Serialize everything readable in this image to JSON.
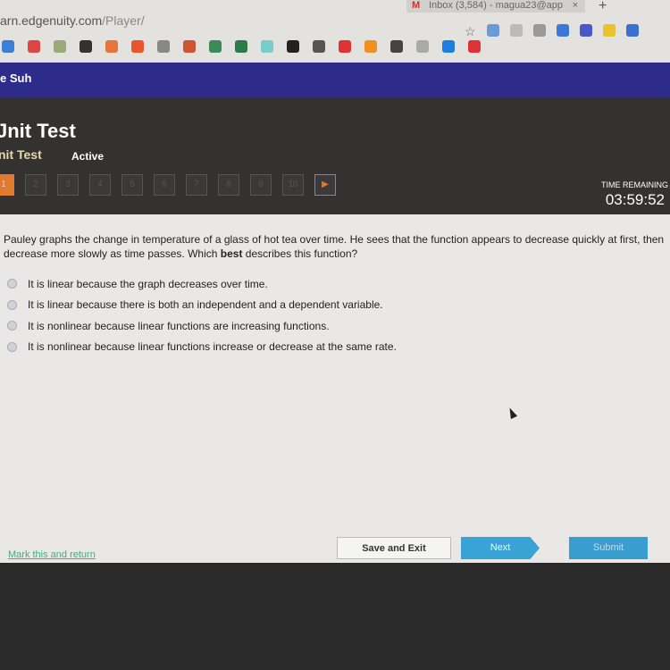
{
  "browser": {
    "tab_title": "Inbox (3,584) - magua23@app",
    "tab_close": "×",
    "new_tab": "+",
    "url_host": "arn.edgenuity.com",
    "url_path": "/Player/",
    "star": "☆",
    "extension_colors": [
      "#6a9bd8",
      "#bbb",
      "#999",
      "#3b78d8",
      "#4a57c9",
      "#e8c22f",
      "#3b6fd0"
    ],
    "bookmark_colors": [
      "#3b80d6",
      "#d44",
      "#9a7",
      "#333",
      "#e7743a",
      "#e8562a",
      "#888",
      "#c53",
      "#3a8a5a",
      "#2a7a4a",
      "#7cc",
      "#222",
      "#555",
      "#d33",
      "#f09020",
      "#444",
      "#aaa",
      "#1e7ee0",
      "#d33"
    ]
  },
  "user": {
    "name": "e Suh"
  },
  "header": {
    "title": "Jnit Test",
    "subtitle": "nit Test",
    "status": "Active",
    "questions": [
      "1",
      "2",
      "3",
      "4",
      "5",
      "6",
      "7",
      "8",
      "9",
      "10"
    ],
    "current": 1,
    "next_arrow": "▶",
    "time_label": "TIME REMAINING",
    "time": "03:59:52"
  },
  "question": {
    "text_before": "Pauley graphs the change in temperature of a glass of hot tea over time. He sees that the function appears to decrease quickly at first, then decrease more slowly as time passes. Which ",
    "bold": "best",
    "text_after": " describes this function?",
    "options": [
      "It is linear because the graph decreases over time.",
      "It is linear because there is both an independent and a dependent variable.",
      "It is nonlinear because linear functions are increasing functions.",
      "It is nonlinear because linear functions increase or decrease at the same rate."
    ]
  },
  "footer": {
    "mark": "Mark this and return",
    "save": "Save and Exit",
    "next": "Next",
    "submit": "Submit"
  }
}
